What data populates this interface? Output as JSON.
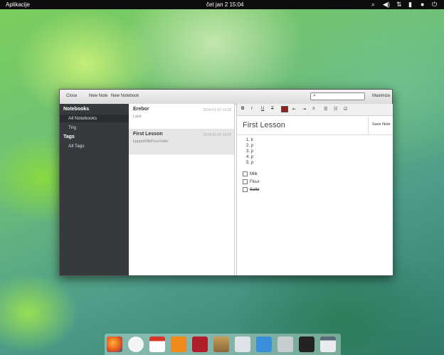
{
  "topbar": {
    "apps": "Aplikacije",
    "clock": "čet jan  2 15:04"
  },
  "toolbar": {
    "close": "Close",
    "new_note": "New Note",
    "new_notebook": "New Notebook",
    "maximize": "Maximize",
    "search_value": ""
  },
  "sidebar": {
    "notebooks_header": "Notebooks",
    "tags_header": "Tags",
    "items": [
      "All Notebooks",
      "Trig"
    ],
    "tags": [
      "All Tags"
    ]
  },
  "notes": [
    {
      "title": "Erebor",
      "date": "2014-01-02 14:28",
      "preview": "Lalal"
    },
    {
      "title": "First Lesson",
      "date": "2014-01-02 14:26",
      "preview": "kppppMilkFlourSaltz"
    }
  ],
  "format": {
    "bold": "B",
    "italic": "I",
    "underline": "U",
    "strike": "T"
  },
  "editor": {
    "title": "First Lesson",
    "save": "Save Note",
    "list": [
      "1.",
      "2.",
      "3.",
      "4.",
      "5."
    ],
    "list_items": [
      "k",
      "p",
      "p",
      "p",
      "p"
    ],
    "checks": [
      "Milk",
      "Flour",
      "Saltz"
    ]
  },
  "colors": {
    "sidebar": "#363a3d",
    "accent": "#3b8fd9"
  }
}
